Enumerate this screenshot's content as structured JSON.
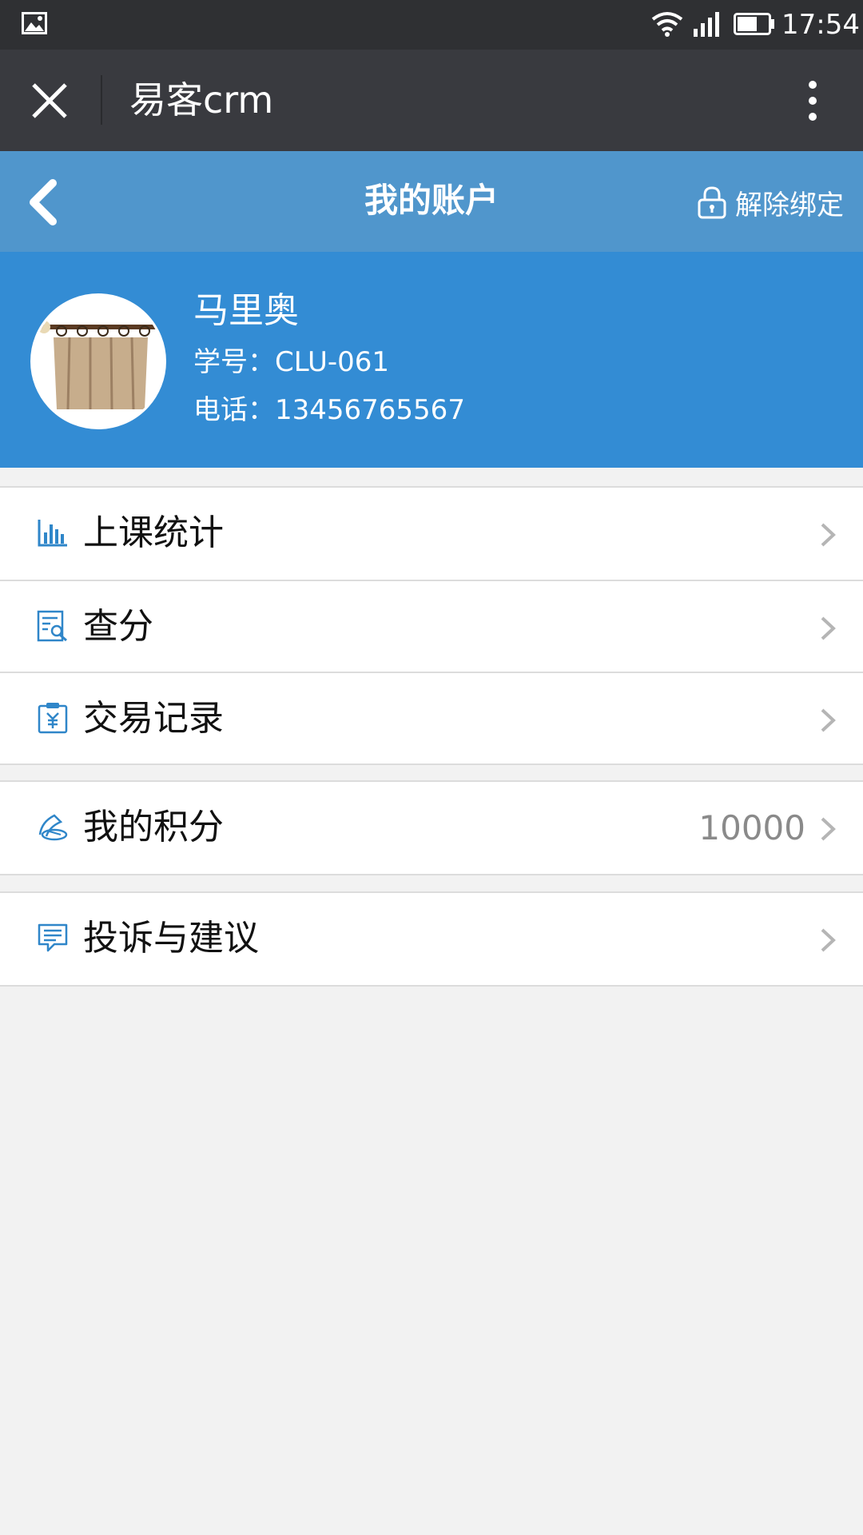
{
  "status_bar": {
    "time": "17:54",
    "icons": [
      "gallery-icon",
      "wifi-icon",
      "signal-icon",
      "battery-icon"
    ]
  },
  "app_bar": {
    "title": "易客crm",
    "icons": [
      "close-icon",
      "more-vertical-icon"
    ]
  },
  "page_header": {
    "title": "我的账户",
    "unbind_label": "解除绑定"
  },
  "profile": {
    "name": "马里奥",
    "student_id_line": "学号：CLU-061",
    "phone_line": "电话：13456765567"
  },
  "menu": {
    "group1": [
      {
        "label": "上课统计",
        "icon": "bar-chart-icon"
      },
      {
        "label": "查分",
        "icon": "score-search-icon"
      },
      {
        "label": "交易记录",
        "icon": "transaction-clipboard-icon"
      }
    ],
    "group2": [
      {
        "label": "我的积分",
        "value": "10000",
        "icon": "points-icon"
      }
    ],
    "group3": [
      {
        "label": "投诉与建议",
        "icon": "message-icon"
      }
    ]
  },
  "colors": {
    "status_bar": "#2f3033",
    "app_bar": "#393a3f",
    "page_header": "#5096cc",
    "profile_bg": "#338cd4",
    "icon_blue": "#2f86c9",
    "page_bg": "#f2f2f2"
  }
}
